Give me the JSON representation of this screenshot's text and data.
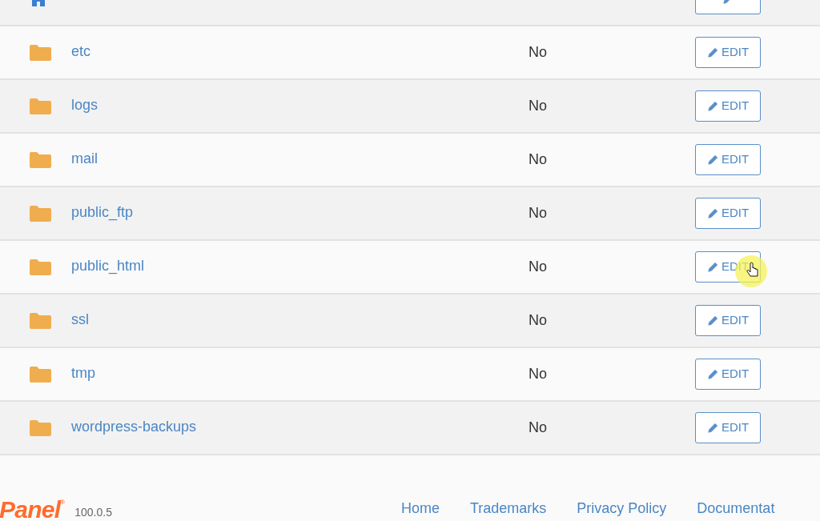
{
  "rows": [
    {
      "kind": "home",
      "pointer": false
    },
    {
      "kind": "folder",
      "name": "etc",
      "status": "No",
      "action": "EDIT",
      "pointer": false
    },
    {
      "kind": "folder",
      "name": "logs",
      "status": "No",
      "action": "EDIT",
      "pointer": false
    },
    {
      "kind": "folder",
      "name": "mail",
      "status": "No",
      "action": "EDIT",
      "pointer": false
    },
    {
      "kind": "folder",
      "name": "public_ftp",
      "status": "No",
      "action": "EDIT",
      "pointer": false
    },
    {
      "kind": "folder",
      "name": "public_html",
      "status": "No",
      "action": "EDIT",
      "pointer": true
    },
    {
      "kind": "folder",
      "name": "ssl",
      "status": "No",
      "action": "EDIT",
      "pointer": false
    },
    {
      "kind": "folder",
      "name": "tmp",
      "status": "No",
      "action": "EDIT",
      "pointer": false
    },
    {
      "kind": "folder",
      "name": "wordpress-backups",
      "status": "No",
      "action": "EDIT",
      "pointer": false
    }
  ],
  "footer": {
    "logo": "Panel",
    "logo_mark": "®",
    "version": "100.0.5",
    "links": [
      "Home",
      "Trademarks",
      "Privacy Policy",
      "Documentat"
    ]
  }
}
